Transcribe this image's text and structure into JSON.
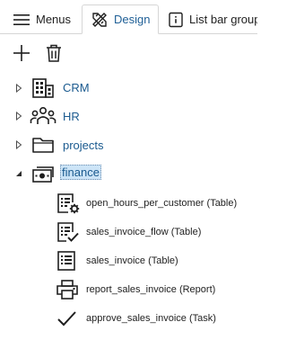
{
  "tabs": [
    {
      "label": "Menus",
      "icon": "hamburger-icon"
    },
    {
      "label": "Design",
      "icon": "design-tools-icon",
      "active": true
    },
    {
      "label": "List bar groups",
      "icon": "list-bar-icon"
    }
  ],
  "toolbar": {
    "add_icon": "plus-icon",
    "delete_icon": "trash-icon"
  },
  "tree": {
    "groups": [
      {
        "label": "CRM",
        "icon": "building-icon",
        "expanded": false
      },
      {
        "label": "HR",
        "icon": "people-icon",
        "expanded": false
      },
      {
        "label": "projects",
        "icon": "folder-icon",
        "expanded": false
      },
      {
        "label": "finance",
        "icon": "money-icon",
        "expanded": true,
        "selected": true
      }
    ],
    "finance_items": [
      {
        "label": "open_hours_per_customer (Table)",
        "icon": "table-settings-icon"
      },
      {
        "label": "sales_invoice_flow (Table)",
        "icon": "table-check-icon"
      },
      {
        "label": "sales_invoice (Table)",
        "icon": "table-icon"
      },
      {
        "label": "report_sales_invoice (Report)",
        "icon": "printer-icon"
      },
      {
        "label": "approve_sales_invoice (Task)",
        "icon": "checkmark-icon"
      }
    ]
  },
  "colors": {
    "accent": "#1f5f96",
    "selection": "#cce4f7",
    "label_blue": "#1a5a8f"
  }
}
